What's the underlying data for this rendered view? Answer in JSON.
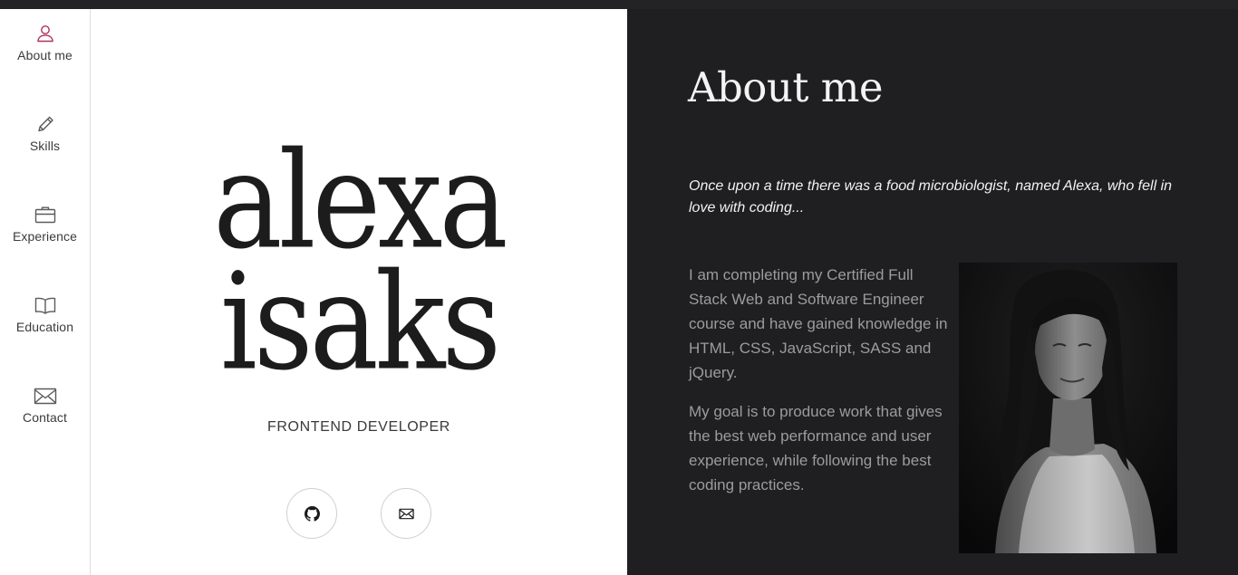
{
  "sidebar": {
    "items": [
      {
        "label": "About me",
        "icon": "user-icon",
        "active": true
      },
      {
        "label": "Skills",
        "icon": "pencil-icon"
      },
      {
        "label": "Experience",
        "icon": "briefcase-icon"
      },
      {
        "label": "Education",
        "icon": "book-icon"
      },
      {
        "label": "Contact",
        "icon": "envelope-icon"
      }
    ]
  },
  "hero": {
    "first_name": "alexa",
    "last_name": "isaks",
    "role": "FRONTEND DEVELOPER",
    "buttons": [
      {
        "icon": "github-icon"
      },
      {
        "icon": "envelope-icon"
      }
    ]
  },
  "about": {
    "title": "About me",
    "intro": "Once upon a time there was a food microbiologist, named Alexa, who fell in love with coding...",
    "paragraphs": [
      "I am completing my Certified Full Stack Web and Software Engineer course and have gained knowledge in HTML, CSS, JavaScript, SASS and jQuery.",
      "My goal is to produce work that gives the best web performance and user experience, while following the best coding practices."
    ]
  },
  "colors": {
    "accent": "#b0305b",
    "panel_dark": "#1f1e20",
    "text_muted": "#9c9c9c",
    "icon_gray": "#5a5a5a"
  }
}
